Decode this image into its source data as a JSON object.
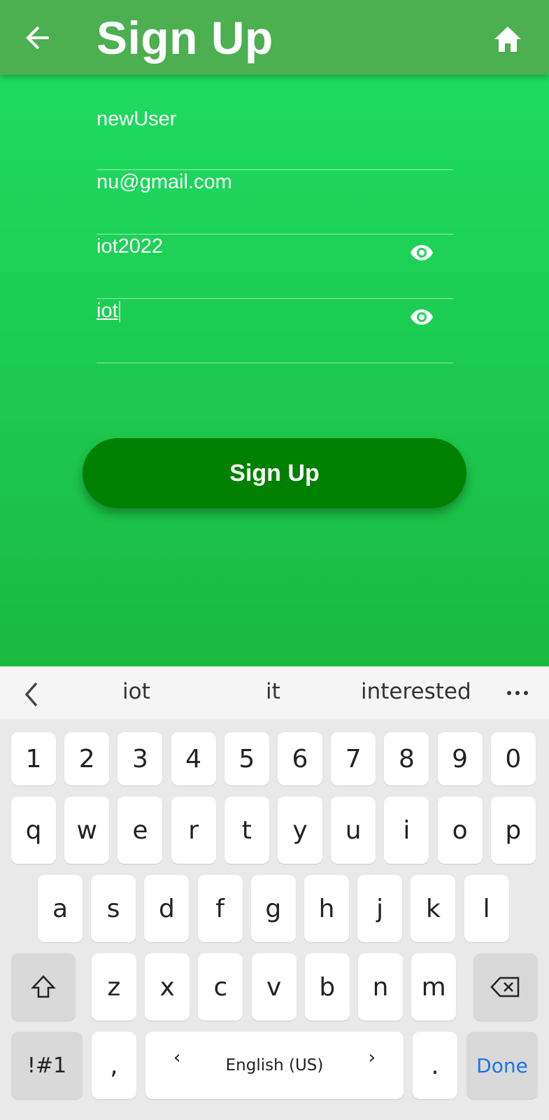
{
  "app": {
    "title": "Sign Up",
    "back_icon": "arrow-left-icon",
    "home_icon": "home-icon",
    "fields": [
      {
        "name": "username",
        "value": "newUser"
      },
      {
        "name": "email",
        "value": "nu@gmail.com"
      },
      {
        "name": "password",
        "value": "iot2022",
        "icon": "eye-icon"
      },
      {
        "name": "confirm-password",
        "value": "iot",
        "icon": "eye-icon"
      }
    ],
    "signup_button": "Sign Up",
    "colors": {
      "appbar": "#4caf50",
      "button": "#008000",
      "bg_top": "#1ee065",
      "bg_bottom": "#1bb93f"
    }
  },
  "keyboard": {
    "suggestions": [
      "iot",
      "it",
      "interested"
    ],
    "row_numbers": [
      "1",
      "2",
      "3",
      "4",
      "5",
      "6",
      "7",
      "8",
      "9",
      "0"
    ],
    "row_top": [
      "q",
      "w",
      "e",
      "r",
      "t",
      "y",
      "u",
      "i",
      "o",
      "p"
    ],
    "row_mid": [
      "a",
      "s",
      "d",
      "f",
      "g",
      "h",
      "j",
      "k",
      "l"
    ],
    "row_bottom": [
      "z",
      "x",
      "c",
      "v",
      "b",
      "n",
      "m"
    ],
    "symbols_key": "!#1",
    "comma_key": ",",
    "space_label": "English (US)",
    "space_left": "‹",
    "space_right": "›",
    "period_key": ".",
    "done_key": "Done"
  }
}
